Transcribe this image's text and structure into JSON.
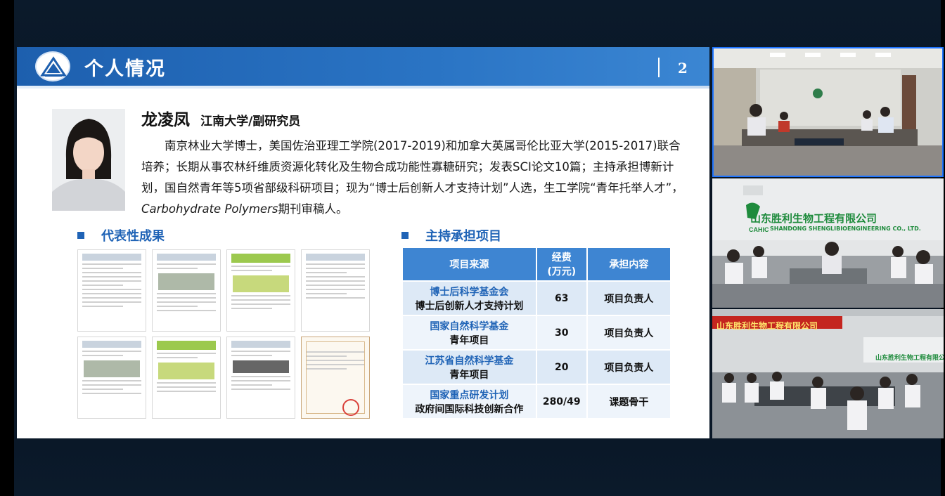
{
  "slide": {
    "title": "个人情况",
    "page_number": "2",
    "person": {
      "name": "龙凌凤",
      "affiliation": "江南大学/副研究员",
      "bio_part1": "南京林业大学博士，美国佐治亚理工学院(2017-2019)和加拿大英属哥伦比亚大学(2015-2017)联合培养；长期从事农林纤维质资源化转化及生物合成功能性寡糖研究；发表SCI论文10篇；主持承担博新计划，国自然青年等5项省部级科研项目；现为“博士后创新人才支持计划”人选，生工学院“青年托举人才”，",
      "bio_journal": "Carbohydrate Polymers",
      "bio_part2": "期刊审稿人。"
    },
    "sections": {
      "achievements": "代表性成果",
      "projects": "主持承担项目"
    },
    "projects_table": {
      "headers": [
        "项目来源",
        "经费",
        "(万元)",
        "承担内容"
      ],
      "rows": [
        {
          "source": "博士后科学基金会",
          "program": "博士后创新人才支持计划",
          "funding": "63",
          "role": "项目负责人"
        },
        {
          "source": "国家自然科学基金",
          "program": "青年项目",
          "funding": "30",
          "role": "项目负责人"
        },
        {
          "source": "江苏省自然科学基金",
          "program": "青年项目",
          "funding": "20",
          "role": "项目负责人"
        },
        {
          "source": "国家重点研发计划",
          "program": "政府间国际科技创新合作",
          "funding": "280/49",
          "role": "课题骨干"
        }
      ]
    }
  },
  "video_feeds": {
    "feed2_sign_cn": "山东胜利生物工程有限公司",
    "feed2_sign_en": "SHANDONG SHENGLIBIOENGINEERING CO., LTD.",
    "feed2_logo": "CAHIC",
    "feed3_banner": "山东胜利生物工程有限公司",
    "feed3_wall_sign": "山东胜利生物工程有限公司"
  },
  "colors": {
    "header_blue": "#2a74c4",
    "section_blue": "#1f63b6",
    "table_header": "#3e85d2",
    "active_feed_border": "#1e74ff"
  }
}
